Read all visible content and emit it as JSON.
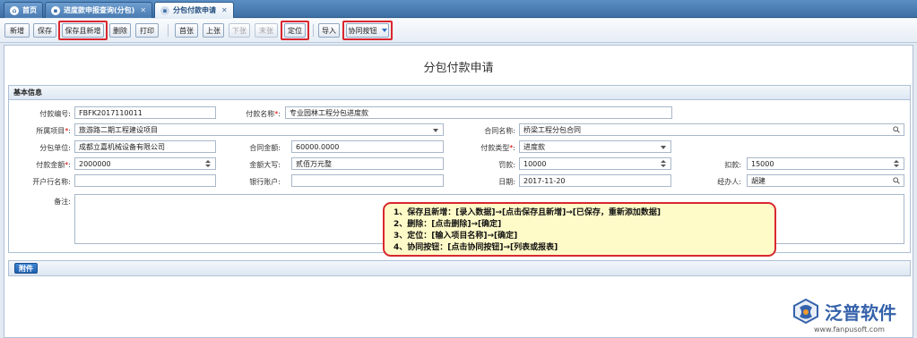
{
  "tabs": [
    {
      "label": "首页",
      "icon": "home-icon"
    },
    {
      "label": "进度款申报查询(分包)",
      "icon": "page-icon"
    },
    {
      "label": "分包付款申请",
      "icon": "page-icon"
    }
  ],
  "toolbar": {
    "new": "新增",
    "save": "保存",
    "save_and_new": "保存且新增",
    "delete": "删除",
    "print": "打印",
    "first": "首张",
    "prev": "上张",
    "next": "下张",
    "last": "末张",
    "locate": "定位",
    "import": "导入",
    "collab": "协同按钮"
  },
  "page": {
    "title": "分包付款申请"
  },
  "basic": {
    "header": "基本信息",
    "pay_no_label": "付款编号:",
    "pay_no": "FBFK2017110011",
    "pay_name_label": "付款名称",
    "pay_name": "专业园林工程分包进度款",
    "project_label": "所属项目",
    "project": "旅游路二期工程建设项目",
    "contract_name_label": "合同名称:",
    "contract_name": "桥梁工程分包合同",
    "sub_unit_label": "分包单位:",
    "sub_unit": "成都立嘉机械设备有限公司",
    "contract_amount_label": "合同金额:",
    "contract_amount": "60000.0000",
    "pay_type_label": "付款类型",
    "pay_type": "进度款",
    "pay_amount_label": "付款金额",
    "pay_amount": "2000000",
    "amount_upper_label": "金额大写:",
    "amount_upper": "贰佰万元整",
    "penalty_label": "罚款:",
    "penalty": "10000",
    "deduct_label": "扣款:",
    "deduct": "15000",
    "bank_name_label": "开户行名称:",
    "bank_name": "",
    "bank_account_label": "银行账户:",
    "bank_account": "",
    "date_label": "日期:",
    "date": "2017-11-20",
    "handler_label": "经办人:",
    "handler": "胡建",
    "memo_label": "备注:"
  },
  "tip": [
    "1、保存且新增：[录入数据]→[点击保存且新增]→[已保存，重新添加数据]",
    "2、删除：[点击删除]→[确定]",
    "3、定位：[输入项目名称]→[确定]",
    "4、协同按钮：[点击协同按钮]→[列表或报表]"
  ],
  "attachment": {
    "label": "附件"
  },
  "brand": {
    "name": "泛普软件",
    "url": "www.fanpusoft.com"
  }
}
